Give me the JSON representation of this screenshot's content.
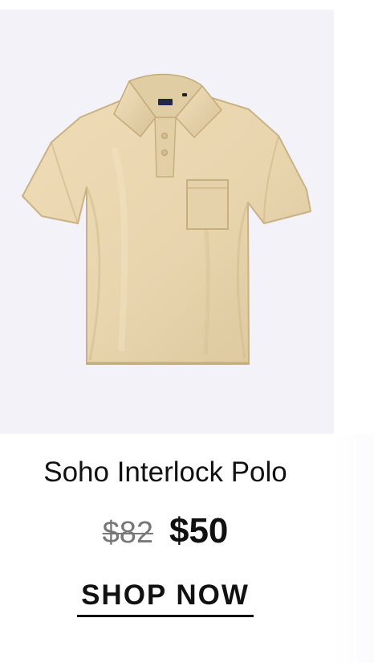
{
  "product": {
    "title": "Soho Interlock Polo",
    "original_price": "$82",
    "sale_price": "$50",
    "cta_label": "SHOP NOW",
    "image_alt": "Soho Interlock Polo",
    "colors": {
      "image_background": "#f3f2f8",
      "shirt": "#e9d7b2",
      "shirt_shadow": "#d8c397"
    },
    "icons": {
      "product_image": "polo-shirt-image"
    }
  }
}
